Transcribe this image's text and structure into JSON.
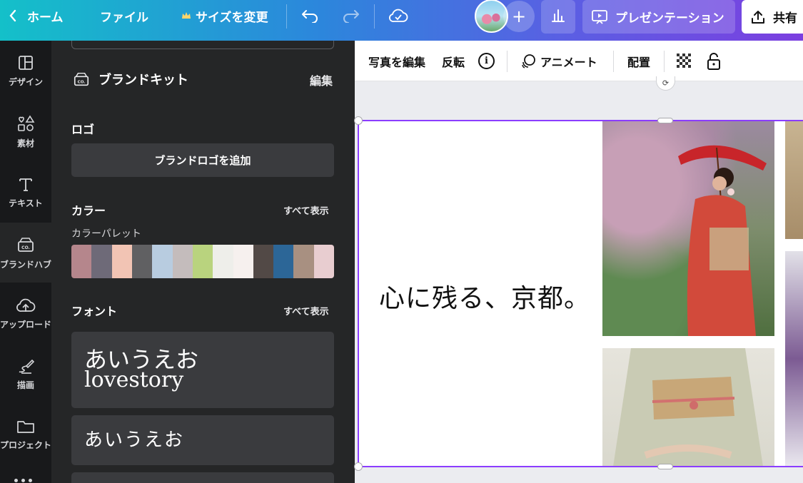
{
  "topbar": {
    "home_label": "ホーム",
    "file_label": "ファイル",
    "resize_label": "サイズを変更",
    "present_label": "プレゼンテーション",
    "share_label": "共有",
    "add_label": "+"
  },
  "rail": {
    "items": [
      {
        "label": "デザイン",
        "icon": "layout-icon"
      },
      {
        "label": "素材",
        "icon": "elements-icon"
      },
      {
        "label": "テキスト",
        "icon": "text-icon"
      },
      {
        "label": "ブランドハブ",
        "icon": "brand-icon"
      },
      {
        "label": "アップロード",
        "icon": "upload-icon"
      },
      {
        "label": "描画",
        "icon": "draw-icon"
      },
      {
        "label": "プロジェクト",
        "icon": "folder-icon"
      }
    ]
  },
  "panel": {
    "brand_kit_title": "ブランドキット",
    "edit_label": "編集",
    "logo_title": "ロゴ",
    "add_logo_label": "ブランドロゴを追加",
    "color_title": "カラー",
    "color_see_all": "すべて表示",
    "palette_label": "カラーパレット",
    "palette": [
      "#b5868c",
      "#6e6a78",
      "#f2c4b4",
      "#606062",
      "#b8cce0",
      "#c4bcbc",
      "#b9d37e",
      "#eeeeea",
      "#f6f0ee",
      "#524946",
      "#2c6697",
      "#a89081",
      "#e8cdd0"
    ],
    "font_title": "フォント",
    "font_see_all": "すべて表示",
    "font_card1_line1": "あいうえお",
    "font_card1_line2": "lovestory",
    "font_card2_line1": "あいうえお"
  },
  "context_toolbar": {
    "edit_photo_label": "写真を編集",
    "flip_label": "反転",
    "info_label": "i",
    "animate_label": "アニメート",
    "position_label": "配置"
  },
  "canvas": {
    "headline": "心に残る、京都。"
  },
  "colors": {
    "accent": "#8b3dff",
    "panel_bg": "#252627",
    "rail_bg": "#18191b"
  }
}
